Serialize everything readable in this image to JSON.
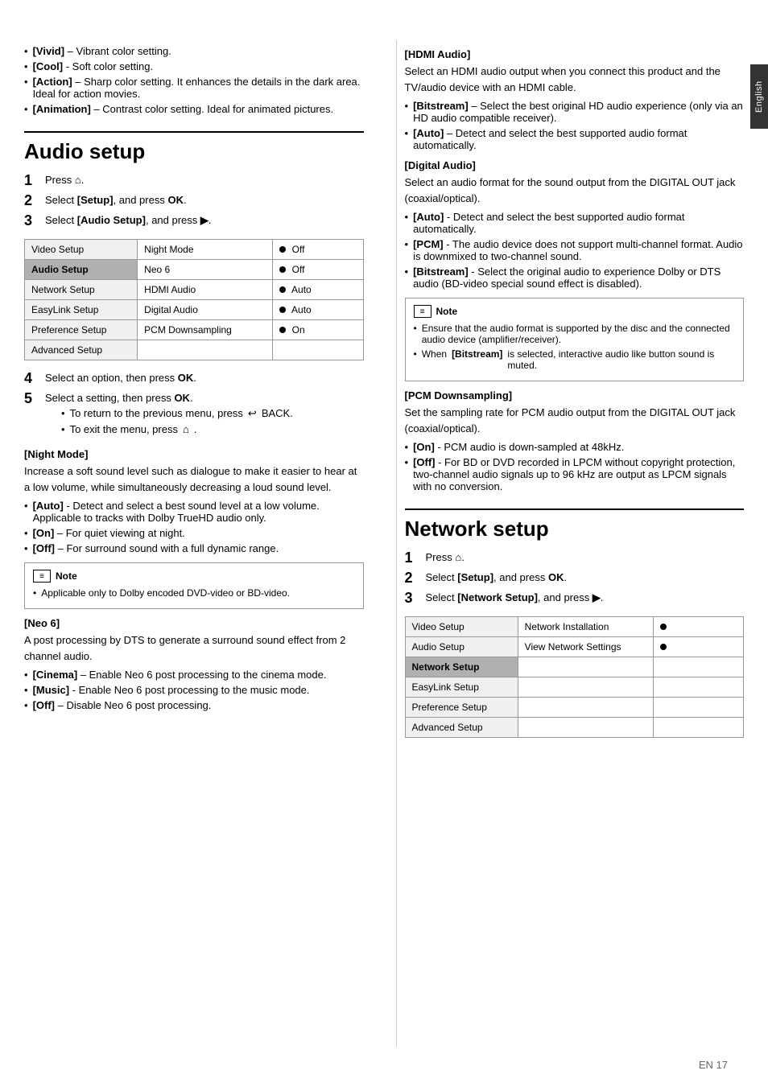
{
  "page": {
    "footer": "EN  17",
    "side_tab": "English"
  },
  "left_col": {
    "intro_bullets": [
      "[Vivid] – Vibrant color setting.",
      "[Cool] - Soft color setting.",
      "[Action] – Sharp color setting. It enhances the details in the dark area. Ideal for action movies.",
      "[Animation] – Contrast color setting. Ideal for animated pictures."
    ],
    "audio_setup": {
      "heading": "Audio setup",
      "steps": [
        {
          "num": "1",
          "text": "Press "
        },
        {
          "num": "2",
          "text": "Select [Setup], and press OK."
        },
        {
          "num": "3",
          "text": "Select [Audio Setup], and press ▶."
        }
      ],
      "table": {
        "menu_items": [
          "Video Setup",
          "Audio Setup",
          "Network Setup",
          "EasyLink Setup",
          "Preference Setup",
          "Advanced Setup"
        ],
        "active_menu": "Audio Setup",
        "rows": [
          {
            "item": "Night Mode",
            "value": "Off"
          },
          {
            "item": "Neo 6",
            "value": "Off"
          },
          {
            "item": "HDMI Audio",
            "value": "Auto"
          },
          {
            "item": "Digital Audio",
            "value": "Auto"
          },
          {
            "item": "PCM Downsampling",
            "value": "On"
          }
        ]
      },
      "steps2": [
        {
          "num": "4",
          "text": "Select an option, then press OK."
        },
        {
          "num": "5",
          "text": "Select a setting, then press OK."
        }
      ],
      "sub_steps": [
        "To return to the previous menu, press ↩ BACK.",
        "To exit the menu, press 🏠 ."
      ]
    },
    "night_mode": {
      "title": "[Night Mode]",
      "body": "Increase a soft sound level such as dialogue to make it easier to hear at a low volume, while simultaneously decreasing a loud sound level.",
      "bullets": [
        "[Auto] - Detect and select a best sound level at a low volume. Applicable to tracks with Dolby TrueHD audio only.",
        "[On] – For quiet viewing at night.",
        "[Off] – For surround sound with a full dynamic range."
      ],
      "note": {
        "label": "Note",
        "bullets": [
          "Applicable only to Dolby encoded DVD-video or BD-video."
        ]
      }
    },
    "neo6": {
      "title": "[Neo 6]",
      "body": "A post processing by DTS to generate a surround sound effect from 2 channel audio.",
      "bullets": [
        "[Cinema] – Enable Neo 6 post processing to the cinema mode.",
        "[Music] - Enable Neo 6 post processing to the music mode.",
        "[Off] – Disable Neo 6 post processing."
      ]
    }
  },
  "right_col": {
    "hdmi_audio": {
      "title": "[HDMI Audio]",
      "body": "Select an HDMI audio output when you connect this product and the TV/audio device with an HDMI cable.",
      "bullets": [
        "[Bitstream] – Select the best original HD audio experience (only via an HD audio compatible receiver).",
        "[Auto] – Detect and select the best supported audio format automatically."
      ]
    },
    "digital_audio": {
      "title": "[Digital Audio]",
      "body": "Select an audio format for the sound output from the DIGITAL OUT jack (coaxial/optical).",
      "bullets": [
        "[Auto] - Detect and select the best supported audio format automatically.",
        "[PCM] - The audio device does not support multi-channel format. Audio is downmixed to two-channel sound.",
        "[Bitstream] - Select the original audio to experience Dolby or DTS audio (BD-video special sound effect is disabled)."
      ],
      "note": {
        "label": "Note",
        "bullets": [
          "Ensure that the audio format is supported by the disc and the connected audio device (amplifier/receiver).",
          "When [Bitstream] is selected, interactive audio like button sound is muted."
        ]
      }
    },
    "pcm_downsampling": {
      "title": "[PCM Downsampling]",
      "body": "Set the sampling rate for PCM audio output from the DIGITAL OUT jack (coaxial/optical).",
      "bullets": [
        "[On] - PCM audio is down-sampled at 48kHz.",
        "[Off] - For BD or DVD recorded in LPCM without copyright protection, two-channel audio signals up to 96 kHz are output as LPCM signals with no conversion."
      ]
    },
    "network_setup": {
      "heading": "Network setup",
      "steps": [
        {
          "num": "1",
          "text": "Press "
        },
        {
          "num": "2",
          "text": "Select [Setup], and press OK."
        },
        {
          "num": "3",
          "text": "Select [Network Setup], and press ▶."
        }
      ],
      "table": {
        "menu_items": [
          "Video Setup",
          "Audio Setup",
          "Network Setup",
          "EasyLink Setup",
          "Preference Setup",
          "Advanced Setup"
        ],
        "active_menu": "Network Setup",
        "rows": [
          {
            "item": "Network Installation",
            "value": "•"
          },
          {
            "item": "View Network Settings",
            "value": "•"
          }
        ]
      }
    }
  }
}
